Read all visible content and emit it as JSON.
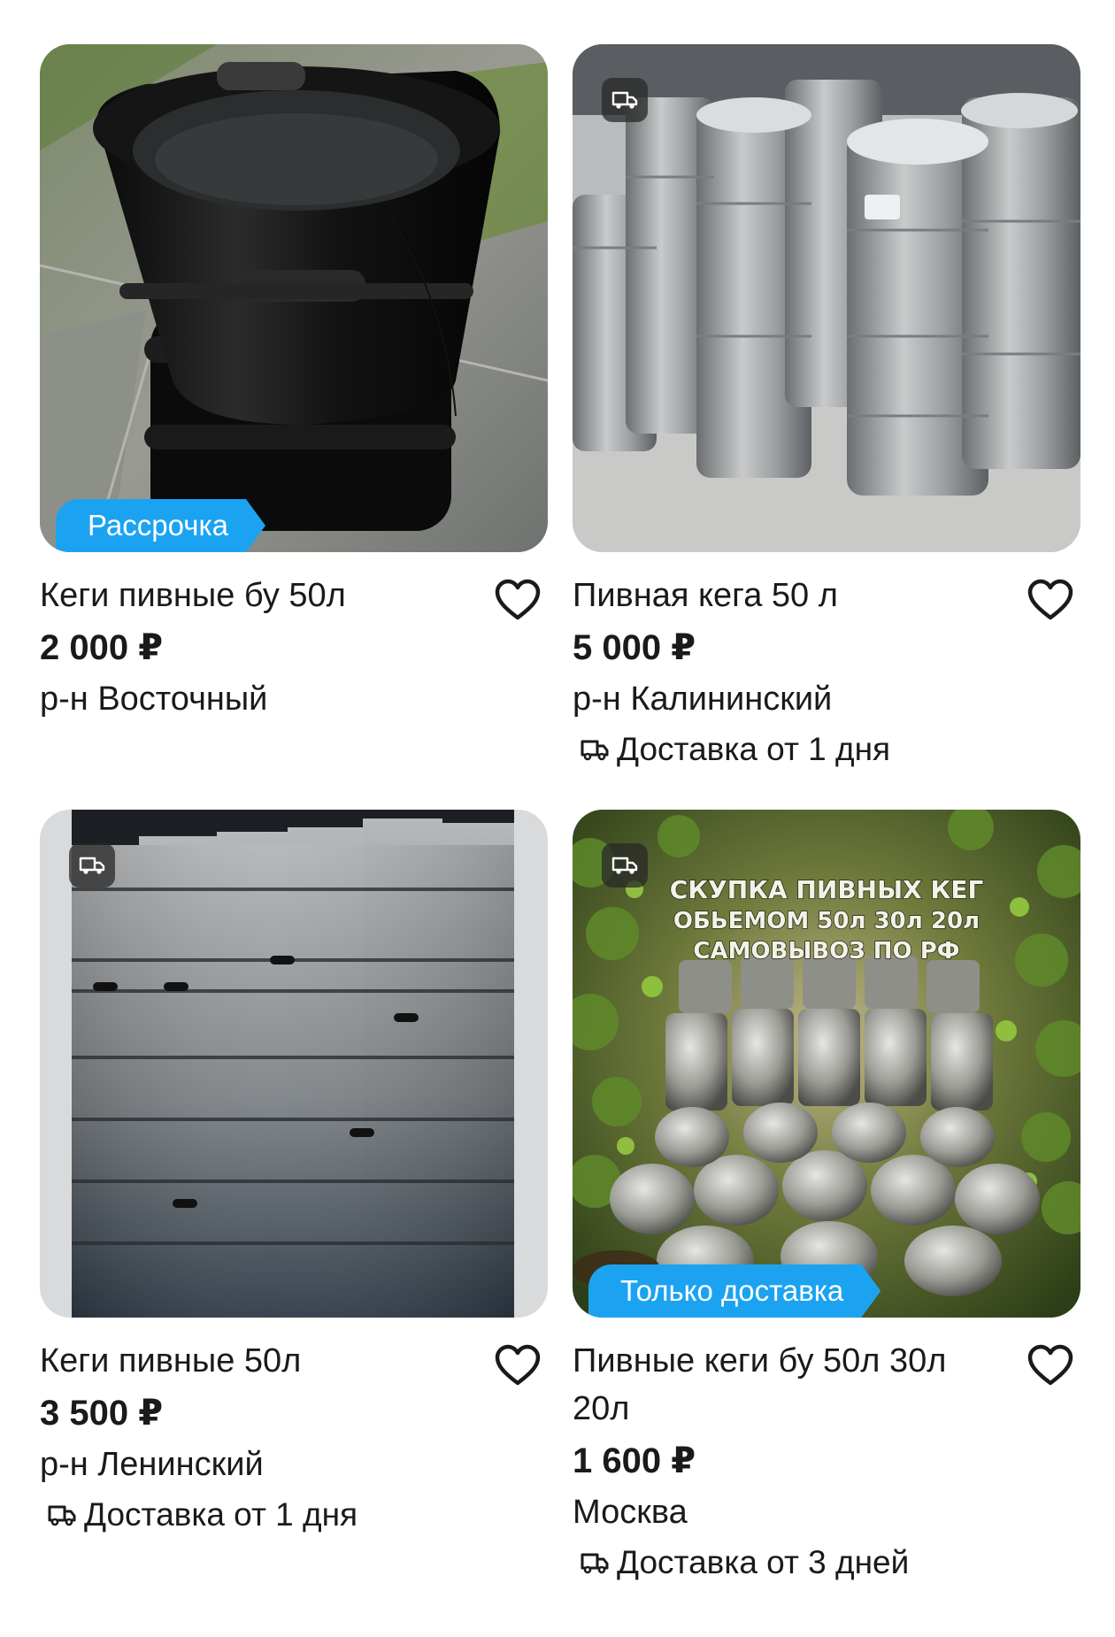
{
  "listings": [
    {
      "title": "Кеги пивные бу 50л",
      "price": "2 000 ₽",
      "location": "р-н Восточный",
      "badge": "Рассрочка",
      "photo_icon": "keg-photo-black",
      "favorite_icon": "heart-outline-icon"
    },
    {
      "title": "Пивная кега 50 л",
      "price": "5 000 ₽",
      "location": "р-н Калининский",
      "delivery": "Доставка от 1 дня",
      "photo_icon": "keg-photo-steel-stack",
      "favorite_icon": "heart-outline-icon"
    },
    {
      "title": "Кеги пивные 50л",
      "price": "3 500 ₽",
      "location": "р-н Ленинский",
      "delivery": "Доставка от 1 дня",
      "photo_icon": "keg-photo-warehouse",
      "favorite_icon": "heart-outline-icon"
    },
    {
      "title": "Пивные кеги бу 50л 30л 20л",
      "price": "1 600 ₽",
      "location": "Москва",
      "delivery": "Доставка от 3 дней",
      "badge": "Только доставка",
      "photo_icon": "keg-photo-hops-ad",
      "photo_caption": [
        "СКУПКА ПИВНЫХ КЕГ",
        "ОБЬЕМОМ 50л 30л 20л",
        "САМОВЫВОЗ ПО РФ"
      ],
      "favorite_icon": "heart-outline-icon"
    }
  ],
  "colors": {
    "badge": "#1ba3f2",
    "text": "#1a1a1a",
    "background": "#ffffff"
  }
}
